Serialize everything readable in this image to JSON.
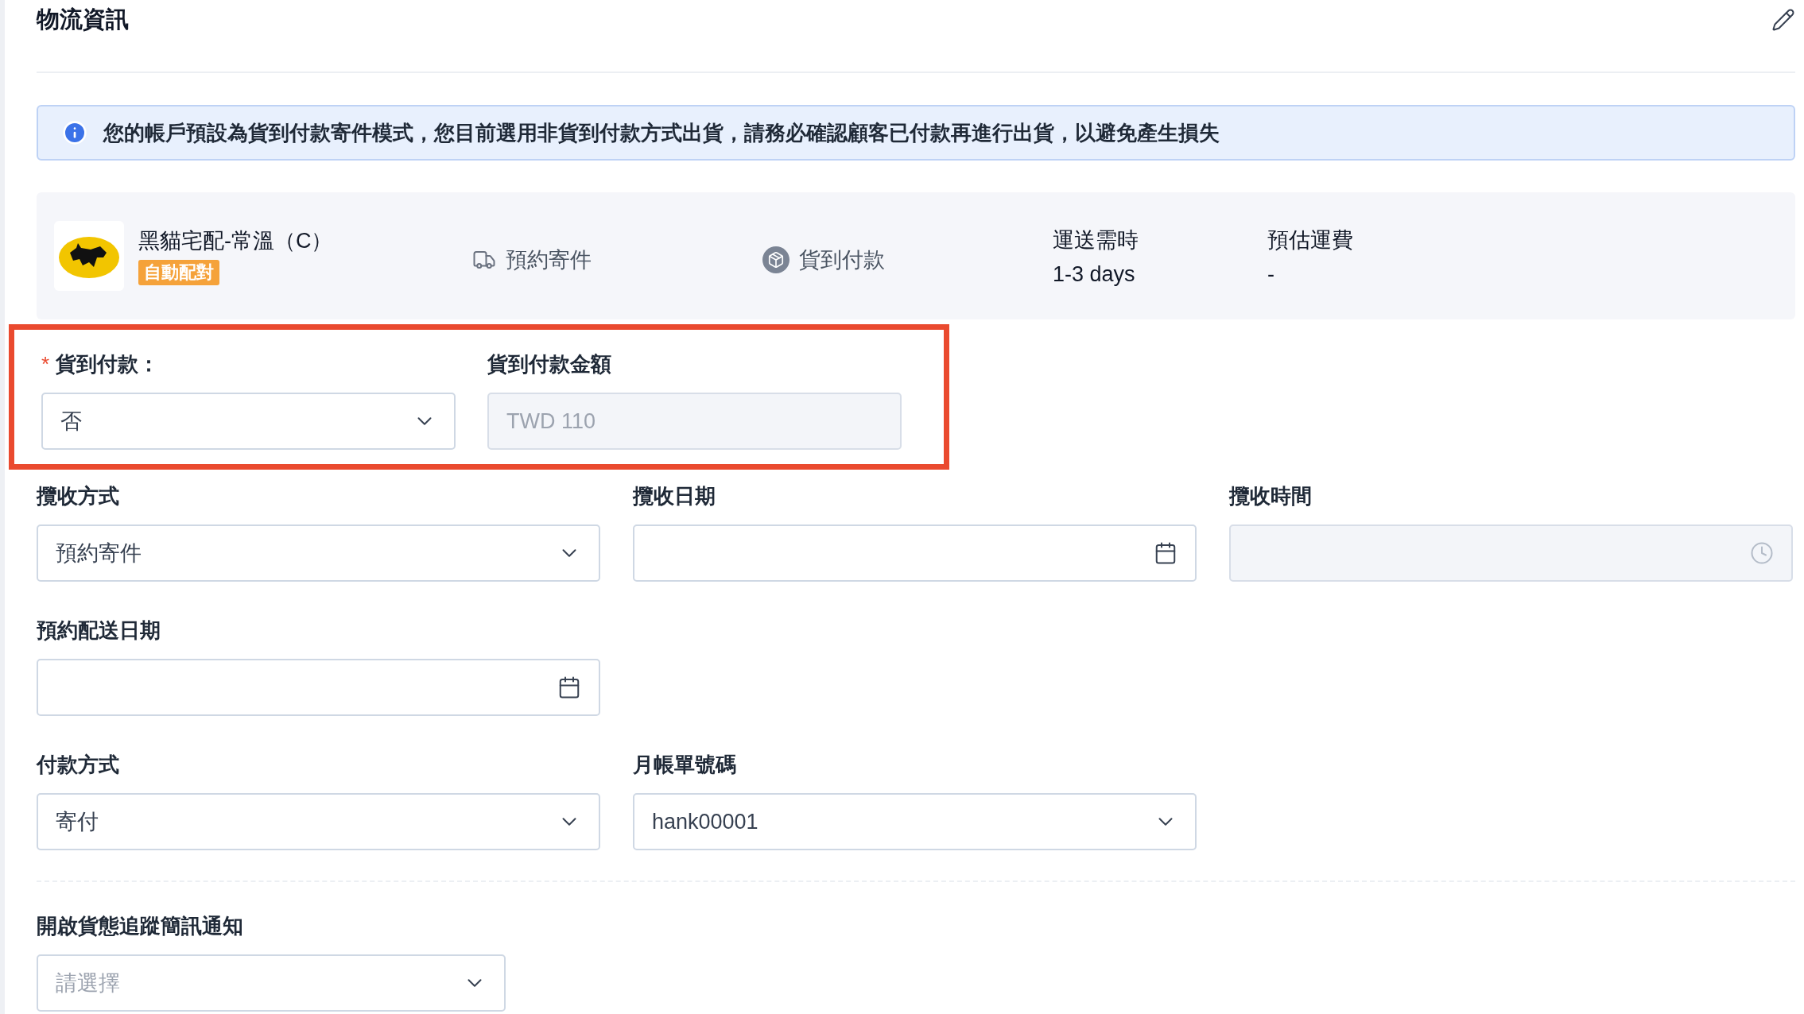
{
  "title": "物流資訊",
  "alert": {
    "text": "您的帳戶預設為貨到付款寄件模式，您目前選用非貨到付款方式出貨，請務必確認顧客已付款再進行出貨，以避免產生損失"
  },
  "carrier": {
    "name": "黑貓宅配-常溫（C）",
    "badge": "自動配對",
    "features": [
      {
        "kind": "truck",
        "label": "預約寄件"
      },
      {
        "kind": "cod",
        "label": "貨到付款"
      }
    ],
    "stats": [
      {
        "label": "運送需時",
        "value": "1-3 days"
      },
      {
        "label": "預估運費",
        "value": "-"
      }
    ]
  },
  "highlighted_fields": [
    {
      "label": "貨到付款：",
      "required_mark": "*",
      "kind": "select",
      "value": "否",
      "disabled": false
    },
    {
      "label": "貨到付款金額",
      "kind": "text",
      "value": "TWD 110",
      "disabled": true
    }
  ],
  "field_rows": [
    [
      {
        "label": "攬收方式",
        "kind": "select",
        "value": "預約寄件",
        "disabled": false
      },
      {
        "label": "攬收日期",
        "kind": "date",
        "disabled": false
      },
      {
        "label": "攬收時間",
        "kind": "time",
        "disabled": true
      }
    ],
    [
      {
        "label": "預約配送日期",
        "kind": "date",
        "disabled": false
      }
    ],
    [
      {
        "label": "付款方式",
        "kind": "select",
        "value": "寄付",
        "disabled": false
      },
      {
        "label": "月帳單號碼",
        "kind": "select",
        "value": "hank00001",
        "disabled": false
      }
    ]
  ],
  "sms_field": {
    "label": "開啟貨態追蹤簡訊通知",
    "kind": "select",
    "placeholder": "請選擇",
    "disabled": false
  }
}
